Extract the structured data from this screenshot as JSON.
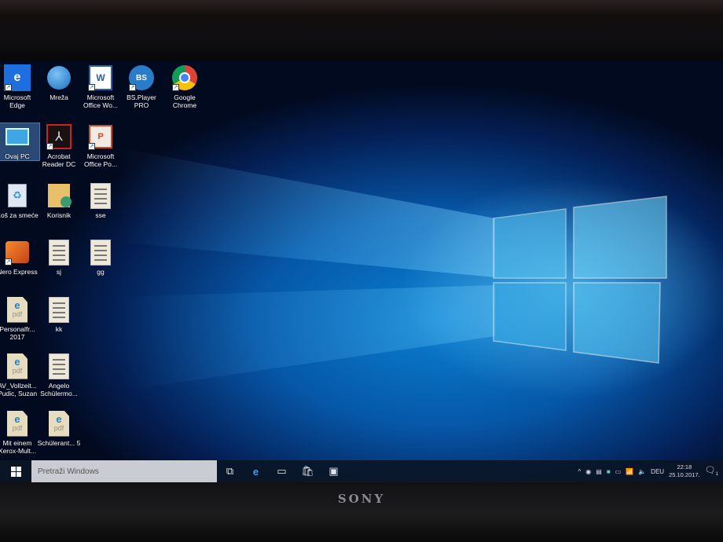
{
  "desktop": {
    "icons": [
      {
        "label": "Microsoft Edge",
        "icon": "edge-icon"
      },
      {
        "label": "Mreža",
        "icon": "network-icon"
      },
      {
        "label": "Microsoft Office Wo...",
        "icon": "word-icon"
      },
      {
        "label": "BS.Player PRO",
        "icon": "bsplayer-icon"
      },
      {
        "label": "Google Chrome",
        "icon": "chrome-icon"
      },
      {
        "label": "Ovaj PC",
        "icon": "this-pc-icon"
      },
      {
        "label": "Acrobat Reader DC",
        "icon": "acrobat-icon"
      },
      {
        "label": "Microsoft Office Po...",
        "icon": "powerpoint-icon"
      },
      {
        "label": "Koš za smeće",
        "icon": "recycle-bin-icon"
      },
      {
        "label": "Korisnik",
        "icon": "user-folder-icon"
      },
      {
        "label": "sse",
        "icon": "document-icon"
      },
      {
        "label": "Nero Express",
        "icon": "nero-icon"
      },
      {
        "label": "sj",
        "icon": "document-icon"
      },
      {
        "label": "gg",
        "icon": "document-icon"
      },
      {
        "label": "Personalfr... 2017",
        "icon": "pdf-icon"
      },
      {
        "label": "kk",
        "icon": "document-icon"
      },
      {
        "label": "AV_Vollzeit... Pudic, Suzan",
        "icon": "pdf-icon"
      },
      {
        "label": "Angelo Schülermo...",
        "icon": "document-icon"
      },
      {
        "label": "Mit einem Xerox-Mult...",
        "icon": "pdf-icon"
      },
      {
        "label": "Schülerant... 5",
        "icon": "pdf-icon"
      }
    ]
  },
  "taskbar": {
    "search_placeholder": "Pretraži Windows",
    "language": "DEU",
    "time": "22:18",
    "date": "25.10.2017.",
    "notification_count": "1"
  },
  "laptop": {
    "brand": "SONY"
  }
}
